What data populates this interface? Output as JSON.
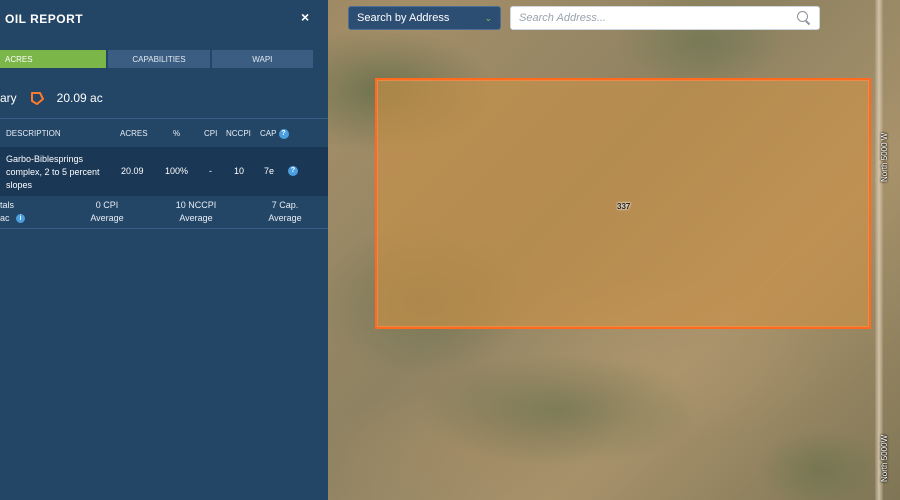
{
  "panel": {
    "title": "OIL REPORT",
    "tabs": [
      {
        "label": "ACRES",
        "active": true
      },
      {
        "label": "CAPABILITIES",
        "active": false
      },
      {
        "label": "WAPI",
        "active": false
      }
    ],
    "summary": {
      "label": "ary",
      "acres": "20.09 ac",
      "boundary_icon": "boundary-polygon-icon"
    },
    "table": {
      "headers": {
        "description": "DESCRIPTION",
        "acres": "ACRES",
        "percent": "%",
        "cpi": "CPI",
        "nccpi": "NCCPI",
        "cap": "CAP"
      },
      "rows": [
        {
          "description": "Garbo-Biblesprings complex, 2 to 5 percent slopes",
          "acres": "20.09",
          "percent": "100%",
          "cpi": "-",
          "nccpi": "10",
          "cap": "7e"
        }
      ]
    },
    "totals": {
      "label_line1": "tals",
      "label_line2": "ac",
      "cpi_line1": "0 CPI",
      "cpi_line2": "Average",
      "nccpi_line1": "10 NCCPI",
      "nccpi_line2": "Average",
      "cap_line1": "7 Cap.",
      "cap_line2": "Average"
    }
  },
  "search": {
    "type_label": "Search by Address",
    "placeholder": "Search Address..."
  },
  "map": {
    "parcel_label": "337",
    "road_label_top": "North 5000 W",
    "road_label_bottom": "North 5000W"
  },
  "colors": {
    "panel_bg": "#234566",
    "active_tab": "#7ab648",
    "parcel_border": "#ff6a1f",
    "help_icon": "#4b9ee0"
  }
}
